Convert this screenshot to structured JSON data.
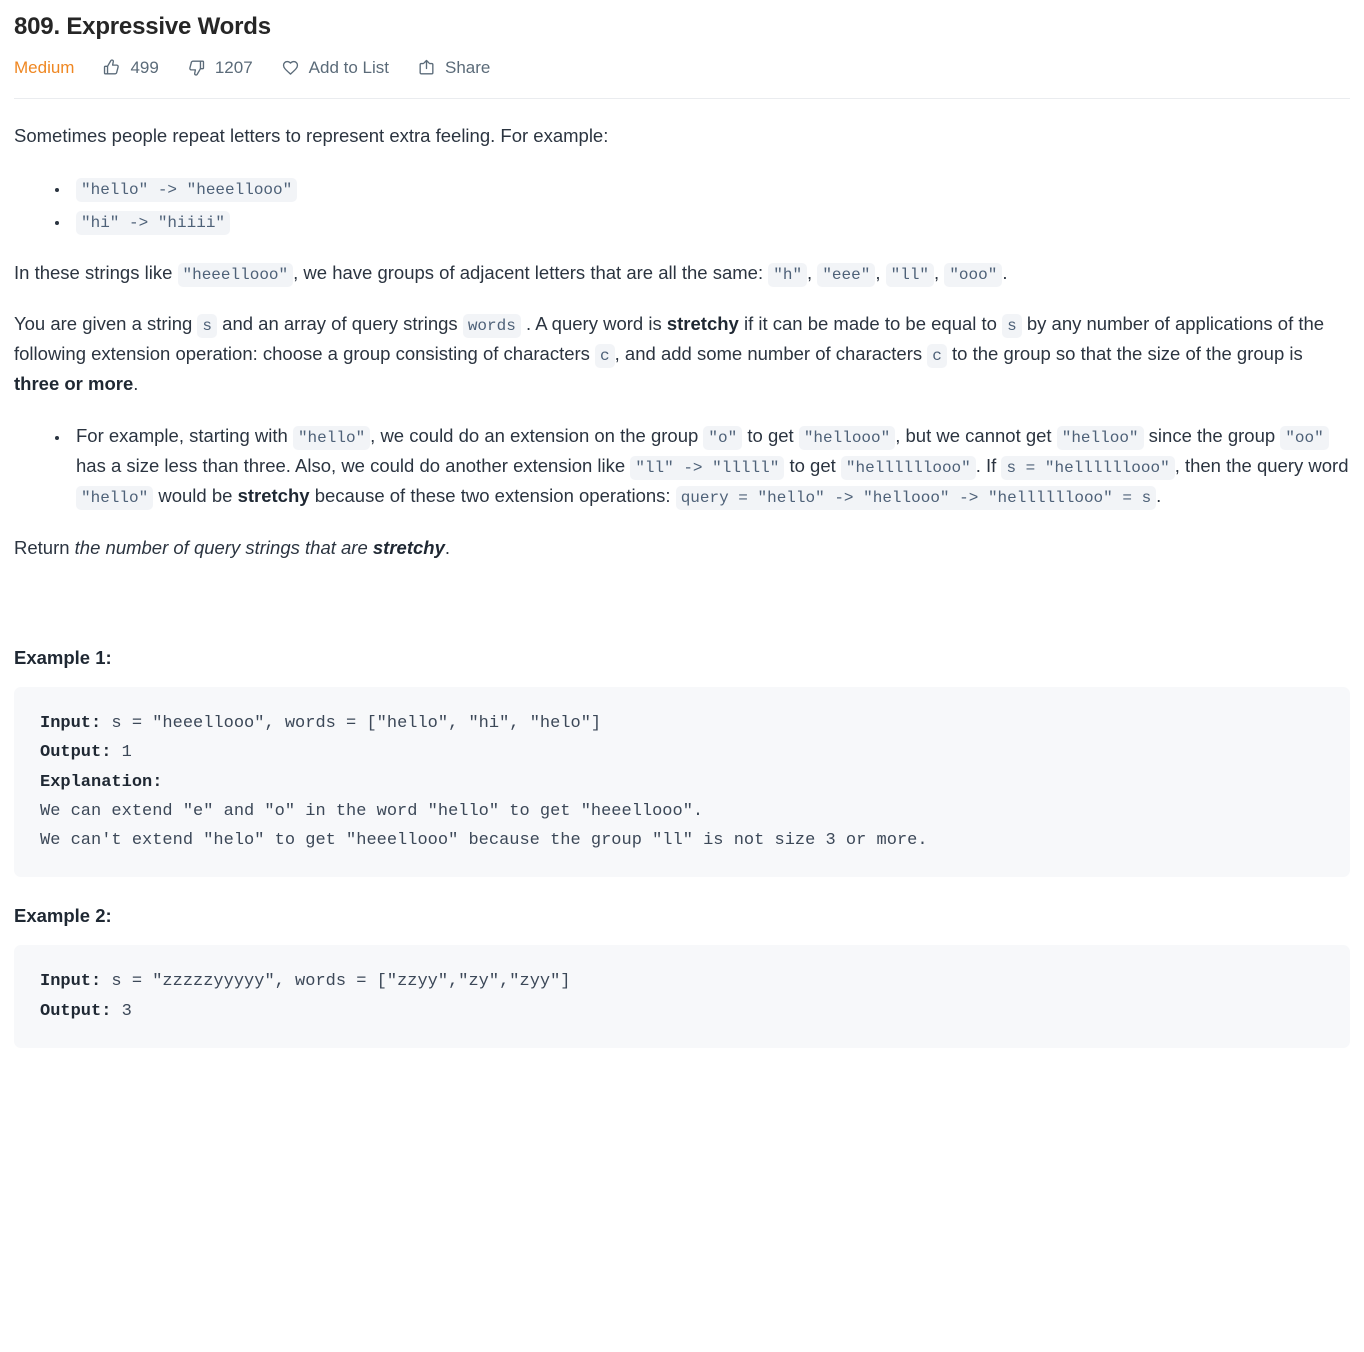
{
  "problem": {
    "title": "809. Expressive Words",
    "difficulty": "Medium",
    "likes": "499",
    "dislikes": "1207",
    "add_to_list_label": "Add to List",
    "share_label": "Share",
    "accent_color": "#ef8722",
    "icons": {
      "like": "thumbs-up-icon",
      "dislike": "thumbs-down-icon",
      "add_to_list": "heart-icon",
      "share": "share-icon"
    }
  },
  "description": {
    "intro": "Sometimes people repeat letters to represent extra feeling. For example:",
    "intro_bullets": [
      "\"hello\" -> \"heeellooo\"",
      "\"hi\" -> \"hiiii\""
    ],
    "groups_p1": "In these strings like",
    "groups_code1": "\"heeellooo\"",
    "groups_p2": ", we have groups of adjacent letters that are all the same:",
    "groups_code2": "\"h\"",
    "groups_sep1": ",",
    "groups_code3": "\"eee\"",
    "groups_sep2": ",",
    "groups_code4": "\"ll\"",
    "groups_sep3": ",",
    "groups_code5": "\"ooo\"",
    "groups_end": ".",
    "given_p1": "You are given a string",
    "given_code_s1": "s",
    "given_p2": "and an array of query strings",
    "given_code_words": "words",
    "given_p3": ". A query word is",
    "given_bold1": "stretchy",
    "given_p4": "if it can be made to be equal to",
    "given_code_s2": "s",
    "given_p5": "by any number of applications of the following extension operation: choose a group consisting of characters",
    "given_code_c1": "c",
    "given_p6": ", and add some number of characters",
    "given_code_c2": "c",
    "given_p7": "to the group so that the size of the group is",
    "given_bold2": "three or more",
    "given_p8": ".",
    "ex_bullet": {
      "t1": "For example, starting with",
      "c1": "\"hello\"",
      "t2": ", we could do an extension on the group",
      "c2": "\"o\"",
      "t3": "to get",
      "c3": "\"hellooo\"",
      "t4": ", but we cannot get",
      "c4": "\"helloo\"",
      "t5": "since the group",
      "c5": "\"oo\"",
      "t6": "has a size less than three. Also, we could do another extension like",
      "c6": "\"ll\" -> \"lllll\"",
      "t7": "to get",
      "c7": "\"hellllllooo\"",
      "t8": ". If",
      "c8": "s = \"hellllllooo\"",
      "t9": ", then the query word",
      "c9": "\"hello\"",
      "t10": "would be",
      "b1": "stretchy",
      "t11": "because of these two extension operations:",
      "c10": "query = \"hello\" -> \"hellooo\" -> \"hellllllooo\" = s",
      "t12": "."
    },
    "return_prefix": "Return",
    "return_italic": "the number of query strings that are",
    "return_bold": "stretchy",
    "return_suffix": "."
  },
  "examples": [
    {
      "heading": "Example 1:",
      "lines": [
        {
          "label": "Input:",
          "text": " s = \"heeellooo\", words = [\"hello\", \"hi\", \"helo\"]"
        },
        {
          "label": "Output:",
          "text": " 1"
        },
        {
          "label": "Explanation:",
          "text": ""
        },
        {
          "label": "",
          "text": "We can extend \"e\" and \"o\" in the word \"hello\" to get \"heeellooo\"."
        },
        {
          "label": "",
          "text": "We can't extend \"helo\" to get \"heeellooo\" because the group \"ll\" is not size 3 or more."
        }
      ]
    },
    {
      "heading": "Example 2:",
      "lines": [
        {
          "label": "Input:",
          "text": " s = \"zzzzzyyyyy\", words = [\"zzyy\",\"zy\",\"zyy\"]"
        },
        {
          "label": "Output:",
          "text": " 3"
        }
      ]
    }
  ]
}
